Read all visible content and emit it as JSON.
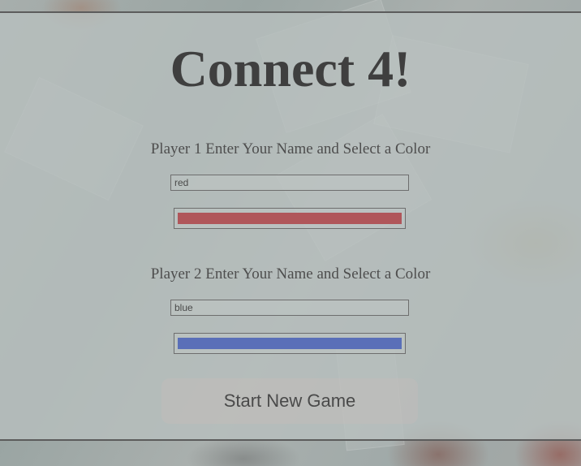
{
  "title": "Connect 4!",
  "player1": {
    "prompt": "Player 1 Enter Your Name and Select a Color",
    "name_value": "red",
    "color": "#b0565a"
  },
  "player2": {
    "prompt": "Player 2 Enter Your Name and Select a Color",
    "name_value": "blue",
    "color": "#5a6fb8"
  },
  "start_button_label": "Start New Game"
}
